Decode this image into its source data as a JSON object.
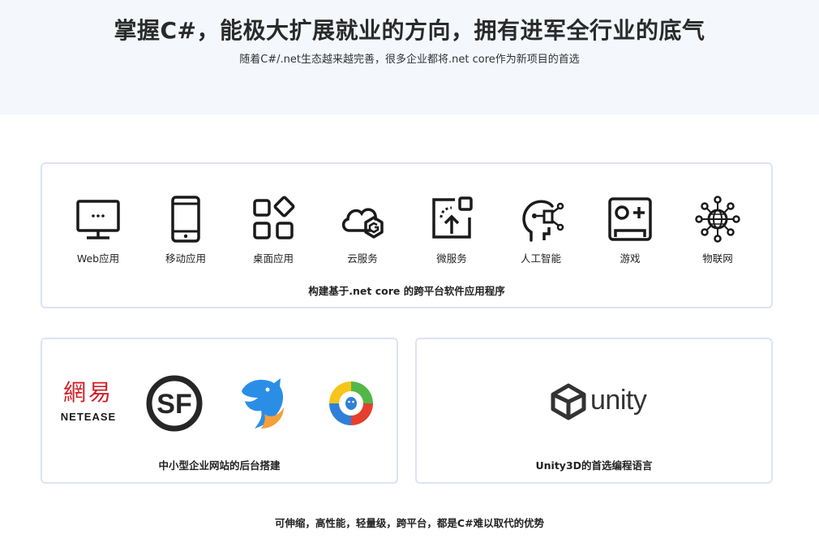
{
  "hero": {
    "title": "掌握C#，能极大扩展就业的方向，拥有进军全行业的底气",
    "subtitle": "随着C#/.net生态越来越完善，很多企业都将.net core作为新项目的首选"
  },
  "platforms": {
    "items": [
      {
        "label": "Web应用",
        "icon": "monitor-icon"
      },
      {
        "label": "移动应用",
        "icon": "mobile-phone-icon"
      },
      {
        "label": "桌面应用",
        "icon": "app-grid-icon"
      },
      {
        "label": "云服务",
        "icon": "cloud-icon"
      },
      {
        "label": "微服务",
        "icon": "microservice-icon"
      },
      {
        "label": "人工智能",
        "icon": "ai-head-icon"
      },
      {
        "label": "游戏",
        "icon": "gamepad-icon"
      },
      {
        "label": "物联网",
        "icon": "iot-globe-icon"
      }
    ],
    "caption": "构建基于.net core 的跨平台软件应用程序"
  },
  "websites": {
    "netease_cn": "網易",
    "netease_en": "NETEASE",
    "sf_text": "SF",
    "caption": "中小型企业网站的后台搭建"
  },
  "unity": {
    "logo_text": "unity",
    "caption": "Unity3D的首选编程语言"
  },
  "footer": {
    "text": "可伸缩，高性能，轻量级，跨平台，都是C#难以取代的优势"
  },
  "colors": {
    "hero_bg": "#f4f8fd",
    "card_border": "#dde3f6",
    "netease_red": "#d1202a",
    "sf_black": "#262626",
    "ctrip_blue": "#2a8ee6",
    "ctrip_orange": "#f2a13a",
    "tencent_green": "#52b748",
    "tencent_yellow": "#f6c51c",
    "tencent_red": "#e63f2f",
    "tencent_blue": "#2f7fd9"
  }
}
